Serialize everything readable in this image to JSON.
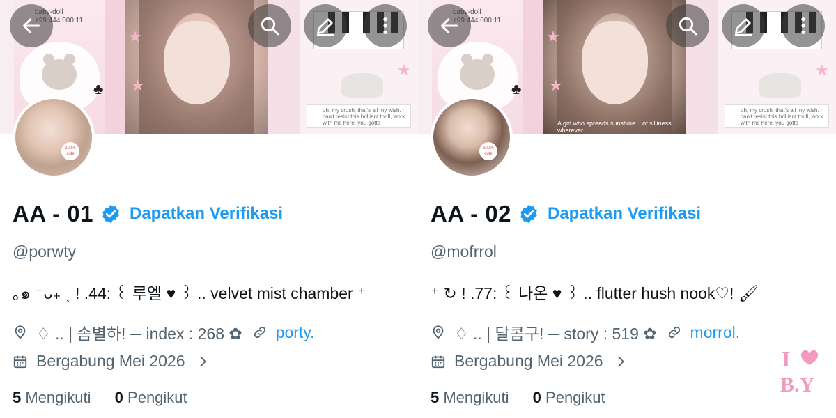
{
  "profiles": [
    {
      "banner": {
        "tag_line1": "baby-doll",
        "tag_line2": "+99 444 000 11",
        "note": "oh, my crush, that's all my wish. i can't resist this brilliant thrill, work with me here, you gotta",
        "caption": ""
      },
      "name": "AA - 01",
      "verify_label": "Dapatkan Verifikasi",
      "handle": "@porwty",
      "bio": "｡๑ ⁻ᴗ₊ ˎ ! .44: ꒰ 루엘 ♥ ꒱ .. velvet mist chamber ⁺",
      "location": "♢ .. | 솜별하! ─  index : 268  ✿",
      "website": "porty.",
      "joined": "Bergabung Mei 2026",
      "following_count": "5",
      "following_label": "Mengikuti",
      "followers_count": "0",
      "followers_label": "Pengikut",
      "avatar_badge": "100% cute"
    },
    {
      "banner": {
        "tag_line1": "baby-doll",
        "tag_line2": "+99 444 000 11",
        "note": "oh, my crush, that's all my wish. i can't resist this brilliant thrill, work with me here, you gotta",
        "caption": "A girl who spreads sunshine... of silliness wherever"
      },
      "name": "AA - 02",
      "verify_label": "Dapatkan Verifikasi",
      "handle": "@mofrrol",
      "bio": "⁺ ↻ ! .77: ꒰ 나온 ♥ ꒱ .. flutter hush nook♡! 🖌",
      "location": "♢ .. | 달콤구! ─  story : 519  ✿",
      "website": "morrol.",
      "joined": "Bergabung Mei 2026",
      "following_count": "5",
      "following_label": "Mengikuti",
      "followers_count": "0",
      "followers_label": "Pengikut",
      "avatar_badge": "100% cute"
    }
  ],
  "watermark": {
    "text_top": "I",
    "text_bottom": "B.Y",
    "color": "#f29ac0"
  },
  "icons": [
    "back-arrow-icon",
    "search-icon",
    "edit-icon",
    "barcode-icon",
    "more-vertical-icon",
    "verified-badge-icon",
    "location-pin-icon",
    "link-icon",
    "calendar-icon",
    "chevron-right-icon",
    "heart-icon"
  ],
  "colors": {
    "accent": "#1d9bf0",
    "text": "#0f1419",
    "muted": "#536471",
    "pink": "#f4b7c9"
  }
}
